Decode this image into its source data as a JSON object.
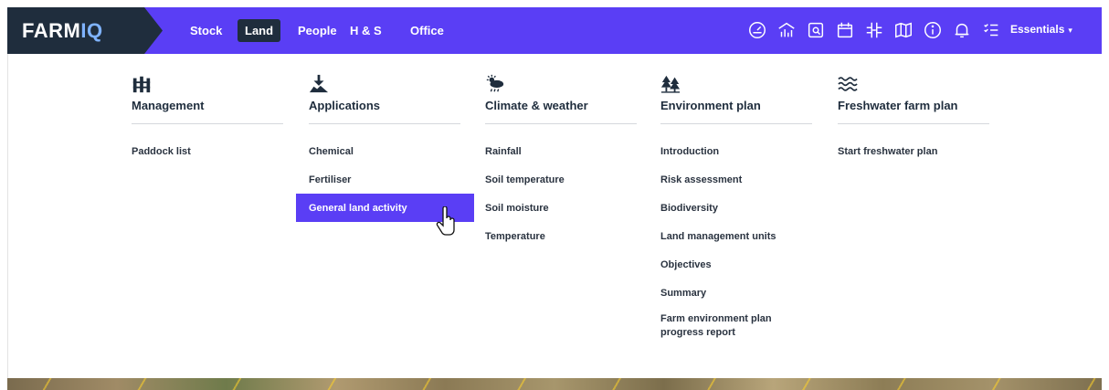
{
  "brand": {
    "logo_main": "FARM",
    "logo_accent": "IQ"
  },
  "nav": {
    "items": [
      {
        "label": "Stock",
        "active": false
      },
      {
        "label": "Land",
        "active": true
      },
      {
        "label": "People",
        "active": false
      },
      {
        "label": "H & S",
        "active": false
      },
      {
        "label": "Office",
        "active": false
      }
    ],
    "icons": [
      "dashboard-gauge-icon",
      "farm-analytics-icon",
      "search-document-icon",
      "calendar-icon",
      "grid-hash-icon",
      "map-icon",
      "info-icon",
      "bell-icon",
      "checklist-icon"
    ],
    "essentials_label": "Essentials"
  },
  "menu": {
    "columns": [
      {
        "title": "Management",
        "icon": "fence-icon",
        "items": [
          "Paddock list"
        ]
      },
      {
        "title": "Applications",
        "icon": "apply-download-icon",
        "items": [
          "Chemical",
          "Fertiliser",
          "General land activity"
        ],
        "highlighted": "General land activity"
      },
      {
        "title": "Climate & weather",
        "icon": "weather-icon",
        "items": [
          "Rainfall",
          "Soil temperature",
          "Soil moisture",
          "Temperature"
        ]
      },
      {
        "title": "Environment plan",
        "icon": "trees-icon",
        "items": [
          "Introduction",
          "Risk assessment",
          "Biodiversity",
          "Land management units",
          "Objectives",
          "Summary",
          "Farm environment plan progress report"
        ]
      },
      {
        "title": "Freshwater farm plan",
        "icon": "water-waves-icon",
        "items": [
          "Start freshwater plan"
        ]
      }
    ]
  },
  "colors": {
    "brand_purple": "#5a3ef5",
    "navy": "#1f2d3d"
  }
}
